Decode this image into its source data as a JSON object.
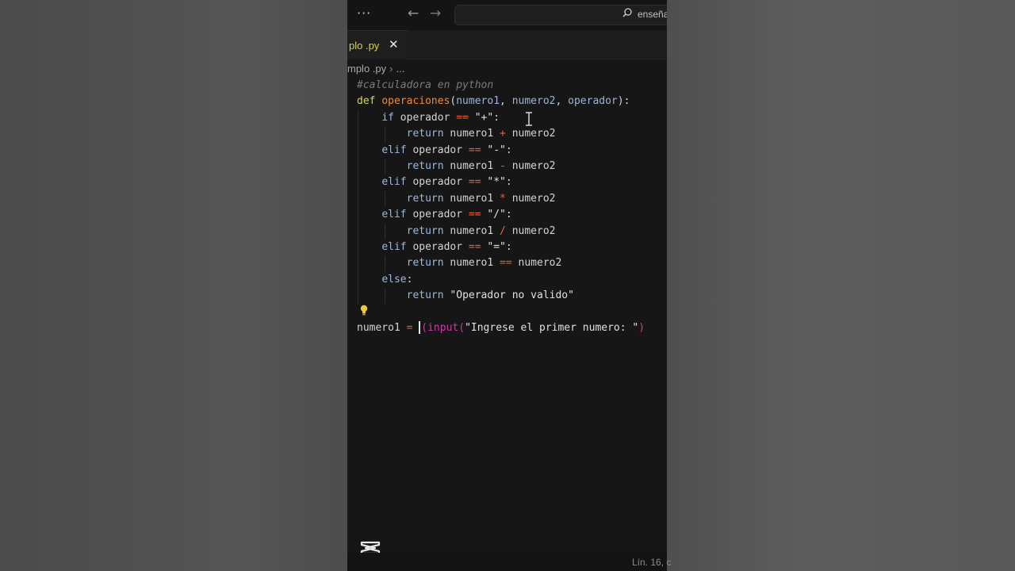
{
  "titlebar": {
    "menu_label": "···",
    "back_arrow": "←",
    "forward_arrow": "→",
    "search_text": "enseña"
  },
  "tab": {
    "label": "plo .py",
    "close_label": "✕"
  },
  "breadcrumb": {
    "file": "mplo .py",
    "separator": "›",
    "more": "..."
  },
  "code_lines": [
    "#calculadora en python",
    "def operaciones(numero1, numero2, operador):",
    "if operador == \"+\":",
    "return numero1 + numero2",
    "elif operador == \"-\":",
    "return numero1 - numero2",
    "elif operador == \"*\":",
    "return numero1 * numero2",
    "elif operador == \"/\":",
    "return numero1 / numero2",
    "elif operador == \"=\":",
    "return numero1 == numero2",
    "else:",
    "return \"Operador no valido\"",
    "",
    "numero1 = (input(\"Ingrese el primer numero: \")"
  ],
  "status": {
    "position": "Lín. 16, c"
  },
  "colors": {
    "keyword": "#d6d652",
    "function": "#f08a3a",
    "parameter": "#9db4d8",
    "operator": "#e8603c",
    "builtin": "#c83ca8",
    "tab_label": "#d7d24c"
  },
  "icons": [
    "more-icon",
    "back-arrow-icon",
    "forward-arrow-icon",
    "search-icon",
    "close-icon",
    "lightbulb-icon",
    "text-cursor-icon",
    "capcut-logo-icon"
  ]
}
